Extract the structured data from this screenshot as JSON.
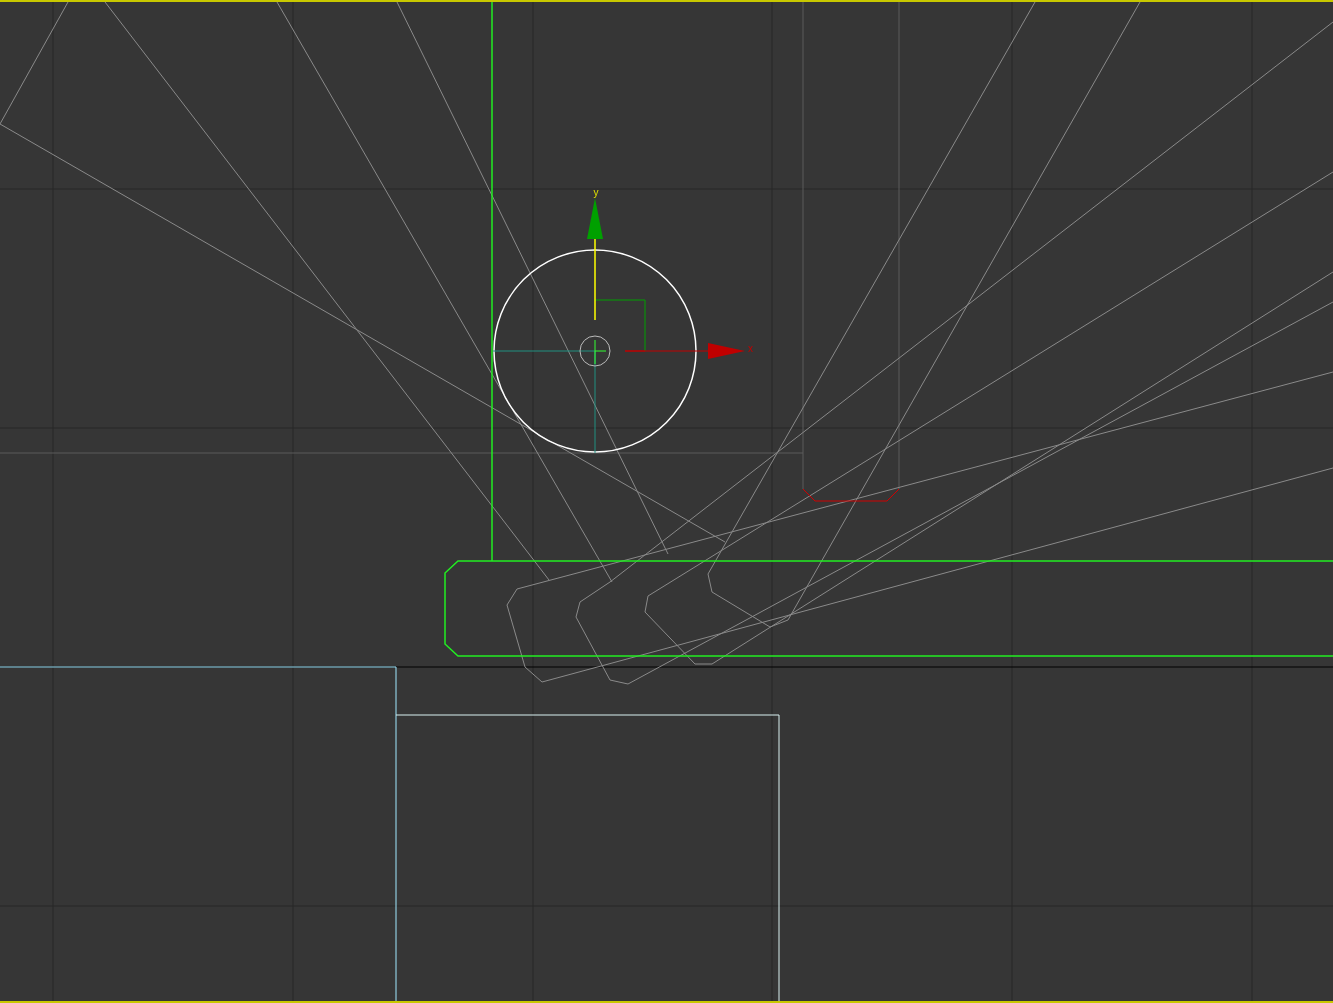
{
  "viewport": {
    "gizmo": {
      "axes": [
        {
          "kind": "y",
          "label": "y",
          "color": "#00a000"
        },
        {
          "kind": "x",
          "label": "x",
          "color": "#c00000"
        }
      ]
    }
  }
}
